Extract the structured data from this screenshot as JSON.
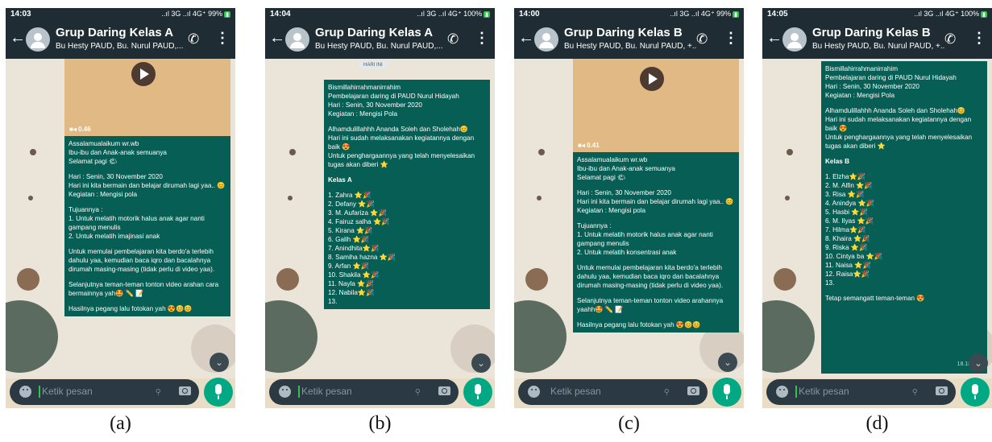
{
  "panels": [
    {
      "caption": "(a)",
      "status": {
        "time": "14:03",
        "signal": "..ıl 3G ..ıl 4G⁺ 99%"
      },
      "header": {
        "title": "Grup Daring Kelas A",
        "subtitle": "Bu Hesty PAUD, Bu. Nurul PAUD,..."
      },
      "video_duration": "■◂ 0.46",
      "lines": [
        "Assalamualaikum wr.wb",
        "Ibu-ibu dan Anak-anak semuanya",
        "Selamat pagi 🌤",
        "",
        "Hari : Senin, 30 November 2020",
        "Hari ini kita bermain dan belajar dirumah lagi yaa.. 😊",
        "Kegiatan : Mengisi pola",
        "",
        "Tujuannya :",
        "1. Untuk melatih motorik halus anak agar nanti gampang menulis",
        "2. Untuk melatih imajinasi anak",
        "",
        "Untuk memulai pembelajaran kita berdo'a terlebih dahulu yaa, kemudian baca iqro dan bacalahnya dirumah masing-masing (tidak perlu di video yaa).",
        "",
        " Selanjutnya teman-teman tonton video arahan cara bermainnya yah🤩 ✏️ 📝",
        "",
        "Hasilnya pegang lalu fotokan yah 😍😊😊"
      ]
    },
    {
      "caption": "(b)",
      "status": {
        "time": "14:04",
        "signal": "..ıl 3G ..ıl 4G⁺ 100%"
      },
      "header": {
        "title": "Grup Daring Kelas A",
        "subtitle": "Bu Hesty PAUD, Bu. Nurul PAUD,..."
      },
      "date_chip": "HARI INI",
      "lines": [
        "Bismillahirrahmanirrahim",
        "Pembelajaran daring di PAUD Nurul Hidayah",
        "Hari : Senin, 30 November 2020",
        "Kegiatan : Mengisi Pola",
        "",
        "Alhamdulillahhh Ananda Soleh dan Sholehah😊",
        "Hari ini sudah melaksanakan kegiatannya dengan baik 😍",
        "Untuk penghargaannya yang telah menyelesaikan tugas akan diberi ⭐",
        "",
        "Kelas A",
        "",
        "1. Zahra ⭐🎉",
        "2. Defany ⭐🎉",
        "3. M. Aufariza ⭐🎉",
        "4. Fairuz salha ⭐🎉",
        "5. Kirana ⭐🎉",
        "6. Galih ⭐🎉",
        "7. Anindhita⭐🎉",
        "8. Samiha hazna ⭐🎉",
        "9. Arfan ⭐🎉",
        "10. Shakila ⭐🎉",
        "11. Nayla ⭐🎉",
        "12. Nabila⭐🎉",
        "13."
      ]
    },
    {
      "caption": "(c)",
      "status": {
        "time": "14:00",
        "signal": "..ıl 3G ..ıl 4G⁺ 99%"
      },
      "header": {
        "title": "Grup Daring Kelas B",
        "subtitle": "Bu Hesty PAUD, Bu. Nurul PAUD, +..."
      },
      "video_duration": "■◂ 0.41",
      "lines": [
        "Assalamualaikum wr.wb",
        "Ibu-ibu dan Anak-anak semuanya",
        "Selamat pagi 🌤",
        "",
        "Hari : Senin, 30 November 2020",
        "Hari ini kita bermain dan belajar dirumah lagi yaa.. 😊",
        "Kegiatan : Mengisi pola",
        "",
        "Tujuannya :",
        "1. Untuk melatih motorik halus anak agar nanti gampang menulis",
        "2. Untuk melatih konsentrasi anak",
        "",
        "Untuk memulai pembelajaran kita berdo'a terlebih dahulu yaa, kemudian baca iqro dan bacalahnya dirumah masing-masing (tidak perlu di video yaa).",
        "",
        " Selanjutnya teman-teman tonton video arahannya yaahh🤩 ✏️ 📝",
        "",
        "Hasilnya pegang lalu fotokan yah 😍😊😊"
      ]
    },
    {
      "caption": "(d)",
      "status": {
        "time": "14:05",
        "signal": "..ıl 3G ..ıl 4G⁺ 100%"
      },
      "header": {
        "title": "Grup Daring Kelas B",
        "subtitle": "Bu Hesty PAUD, Bu. Nurul PAUD, +..."
      },
      "time_sent": "18.18 ✓",
      "lines": [
        "Bismillahirrahmanirrahim",
        "Pembelajaran daring di PAUD Nurul Hidayah",
        "Hari : Senin, 30 November 2020",
        "Kegiatan : Mengisi Pola",
        "",
        "Alhamdulillahhh Ananda Soleh dan Sholehah😊",
        "Hari ini sudah melaksanakan kegiatannya dengan baik 😍",
        "Untuk penghargaannya yang telah menyelesaikan tugas akan diberi ⭐",
        "",
        "Kelas B",
        "",
        "1. Elzha⭐🎉",
        "2. M. Alfin ⭐🎉",
        "3. Risa ⭐🎉",
        "4. Anindya ⭐🎉",
        "5. Hasbi ⭐🎉",
        "6. M. Ilyas ⭐🎉",
        "7. Hilma⭐🎉",
        "8. Khaira ⭐🎉",
        "9. Riska ⭐🎉",
        "10. Cintya ba ⭐🎉",
        "11. Naisa ⭐🎉",
        "12. Raisa⭐🎉",
        "13.",
        "",
        "Tetap semangatt teman-teman 😍"
      ]
    }
  ],
  "input": {
    "placeholder": "Ketik pesan"
  },
  "icons": {
    "back": "arrow-left-icon",
    "call": "add-call-icon",
    "menu": "more-vert-icon",
    "emoji": "emoji-icon",
    "attach": "paperclip-icon",
    "camera": "camera-icon",
    "mic": "mic-icon",
    "scroll": "chevron-double-down-icon",
    "play": "play-icon"
  },
  "colors": {
    "header": "#1f2c33",
    "bubble": "#075e54",
    "accent": "#00a884",
    "wallpaper": "#ebe5d9"
  }
}
